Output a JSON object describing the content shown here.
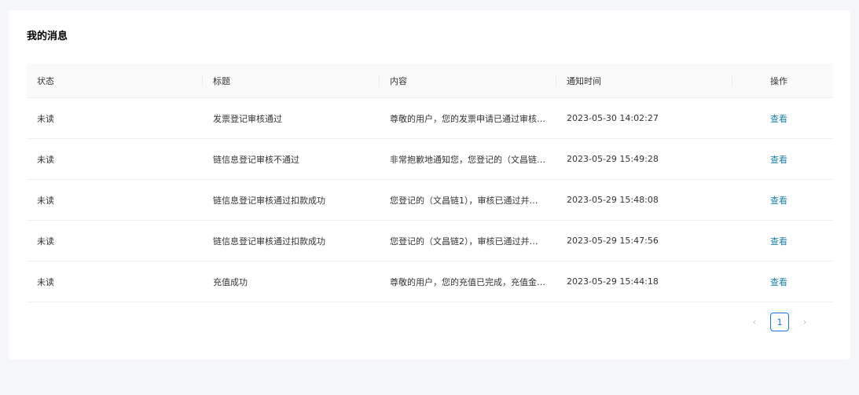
{
  "page": {
    "title": "我的消息"
  },
  "table": {
    "headers": [
      "状态",
      "标题",
      "内容",
      "通知时间",
      "操作"
    ],
    "rows": [
      {
        "status": "未读",
        "title": "发票登记审核通过",
        "content": "尊敬的用户，您的发票申请已通过审核…",
        "time": "2023-05-30 14:02:27",
        "action": "查看"
      },
      {
        "status": "未读",
        "title": "链信息登记审核不通过",
        "content": "非常抱歉地通知您，您登记的（文昌链…",
        "time": "2023-05-29 15:49:28",
        "action": "查看"
      },
      {
        "status": "未读",
        "title": "链信息登记审核通过扣款成功",
        "content": "您登记的（文昌链1），审核已通过并…",
        "time": "2023-05-29 15:48:08",
        "action": "查看"
      },
      {
        "status": "未读",
        "title": "链信息登记审核通过扣款成功",
        "content": "您登记的（文昌链2），审核已通过并…",
        "time": "2023-05-29 15:47:56",
        "action": "查看"
      },
      {
        "status": "未读",
        "title": "充值成功",
        "content": "尊敬的用户，您的充值已完成，充值金…",
        "time": "2023-05-29 15:44:18",
        "action": "查看"
      }
    ]
  },
  "pagination": {
    "prev_icon": "‹",
    "current_page": "1",
    "next_icon": "›"
  },
  "colors": {
    "link": "#1a7fa6",
    "accent": "#1a73e8",
    "background": "#f5f6fa"
  }
}
